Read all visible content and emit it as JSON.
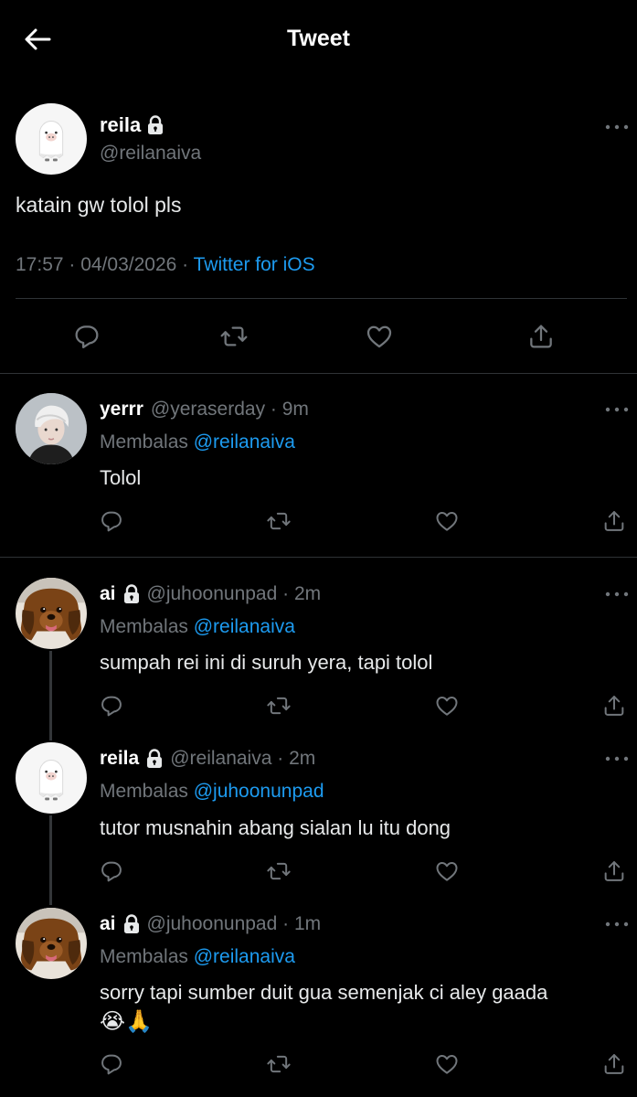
{
  "header": {
    "title": "Tweet",
    "back_icon": "arrow-left-icon"
  },
  "colors": {
    "background": "#000000",
    "text": "#e7e9ea",
    "muted": "#71767b",
    "link": "#1d9bf0",
    "divider": "#2f3336"
  },
  "main_tweet": {
    "name": "reila",
    "handle": "@reilanaiva",
    "locked": true,
    "text": "katain gw tolol pls",
    "time": "17:57 · 04/03/2026 · ",
    "source": "Twitter for iOS"
  },
  "replies": [
    {
      "name": "yerrr",
      "handle": "@yeraserday · 9m",
      "locked": false,
      "replying_prefix": "Membalas",
      "replying_to": "@reilanaiva",
      "text": "Tolol"
    },
    {
      "name": "ai",
      "handle": "@juhoonunpad · 2m",
      "locked": true,
      "replying_prefix": "Membalas",
      "replying_to": "@reilanaiva",
      "text": "sumpah rei ini di suruh yera, tapi tolol"
    },
    {
      "name": "reila",
      "handle": "@reilanaiva · 2m",
      "locked": true,
      "replying_prefix": "Membalas",
      "replying_to": "@juhoonunpad",
      "text": "tutor musnahin abang sialan lu itu dong"
    },
    {
      "name": "ai",
      "handle": "@juhoonunpad · 1m",
      "locked": true,
      "replying_prefix": "Membalas",
      "replying_to": "@reilanaiva",
      "text": "sorry tapi sumber duit gua semenjak ci aley gaada",
      "emoji": "😭🙏"
    }
  ]
}
